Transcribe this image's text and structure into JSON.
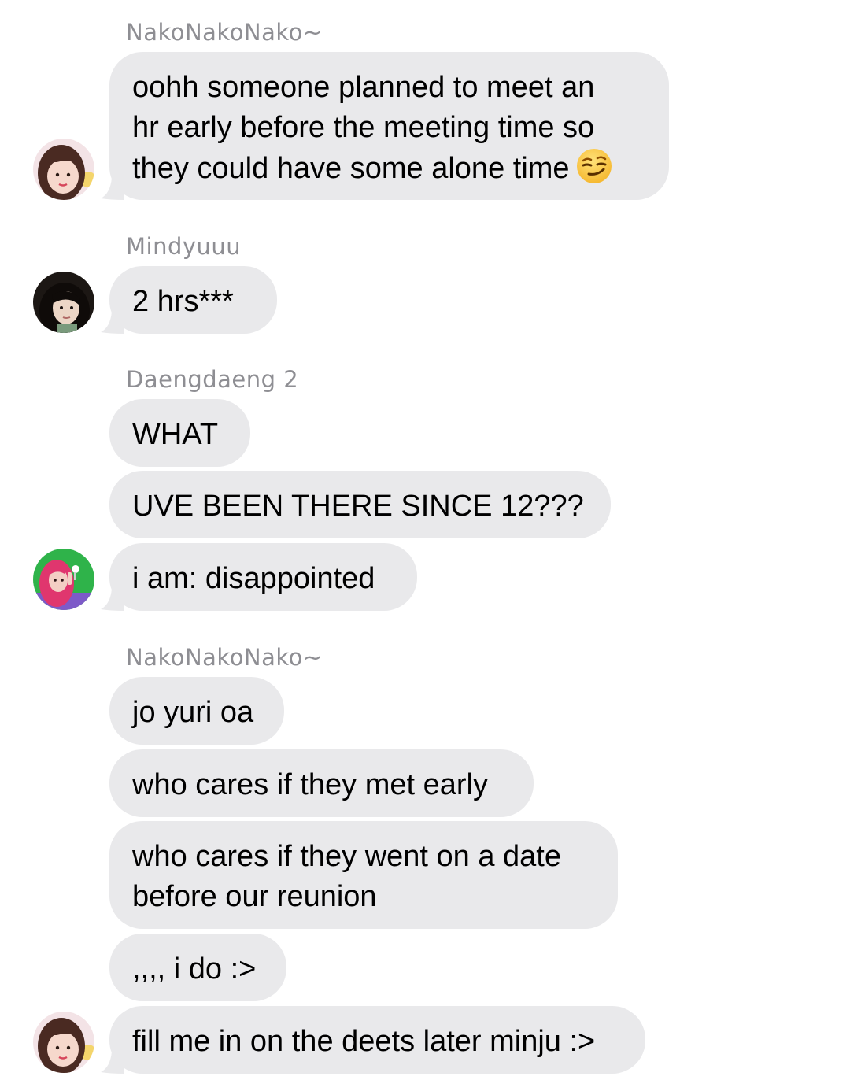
{
  "conversation": {
    "groups": [
      {
        "sender": "NakoNakoNako~",
        "messages": [
          {
            "lines": [
              "oohh someone planned to meet an",
              "hr early before the meeting time so",
              "they could have some alone time"
            ],
            "emoji": "smirking-face-emoji"
          }
        ]
      },
      {
        "sender": "Mindyuuu",
        "messages": [
          {
            "lines": [
              "2 hrs***"
            ]
          }
        ]
      },
      {
        "sender": "Daengdaeng 2",
        "messages": [
          {
            "lines": [
              "WHAT"
            ]
          },
          {
            "lines": [
              "UVE BEEN THERE SINCE 12???"
            ]
          },
          {
            "lines": [
              "i am: disappointed"
            ]
          }
        ]
      },
      {
        "sender": "NakoNakoNako~",
        "messages": [
          {
            "lines": [
              "jo yuri oa"
            ]
          },
          {
            "lines": [
              "who cares if they met early"
            ]
          },
          {
            "lines": [
              "who cares if they went on a date",
              "before our reunion"
            ]
          },
          {
            "lines": [
              ",,,, i do :>"
            ]
          },
          {
            "lines": [
              "fill me in on the deets later minju :>"
            ]
          }
        ]
      }
    ]
  },
  "colors": {
    "bubble": "#e9e9eb",
    "sender_label": "#8e8e93",
    "text": "#000000",
    "background": "#ffffff"
  },
  "avatars": [
    "avatar-nako",
    "avatar-mindyuuu",
    "avatar-daengdaeng",
    "avatar-nako"
  ]
}
